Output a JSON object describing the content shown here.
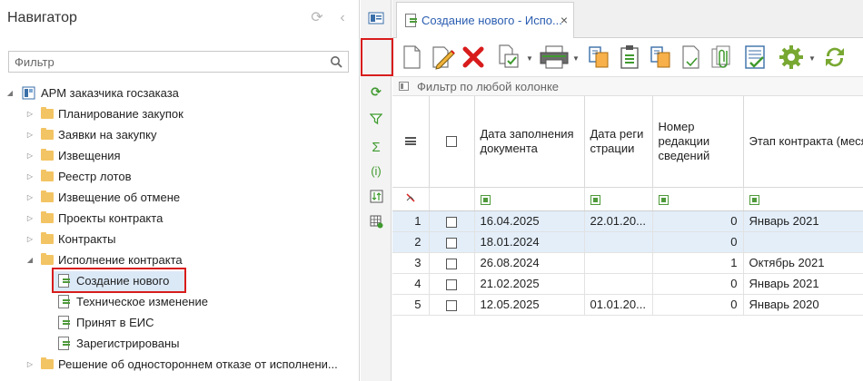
{
  "navigator": {
    "title": "Навигатор",
    "filter_placeholder": "Фильтр",
    "tree": {
      "root": "АРМ заказчика госзаказа",
      "items": [
        "Планирование закупок",
        "Заявки на закупку",
        "Извещения",
        "Реестр лотов",
        "Извещение об отмене",
        "Проекты контракта",
        "Контракты",
        "Исполнение контракта"
      ],
      "children": [
        "Создание нового",
        "Техническое изменение",
        "Принят в ЕИС",
        "Зарегистрированы"
      ],
      "last": "Решение об одностороннем отказе от исполнени..."
    }
  },
  "tab": {
    "label": "Создание нового - Испо...",
    "close": "×"
  },
  "grid": {
    "filter_placeholder": "Фильтр по любой колонке",
    "columns": [
      "Дата заполнения документа",
      "Дата регистрации",
      "Номер редакции сведений",
      "Этап контракта (месяц)"
    ],
    "rows": [
      {
        "n": "1",
        "date_fill": "16.04.2025",
        "date_reg": "22.01.20...",
        "edition": "0",
        "stage": "Январь 2021"
      },
      {
        "n": "2",
        "date_fill": "18.01.2024",
        "date_reg": "",
        "edition": "0",
        "stage": ""
      },
      {
        "n": "3",
        "date_fill": "26.08.2024",
        "date_reg": "",
        "edition": "1",
        "stage": "Октябрь 2021"
      },
      {
        "n": "4",
        "date_fill": "21.02.2025",
        "date_reg": "",
        "edition": "0",
        "stage": "Январь 2021"
      },
      {
        "n": "5",
        "date_fill": "12.05.2025",
        "date_reg": "01.01.20...",
        "edition": "0",
        "stage": "Январь 2020"
      }
    ]
  },
  "colors": {
    "accent_red": "#d81c1c",
    "tab_text": "#2a5db0",
    "selection": "#dbe9f7",
    "green": "#4e9a3a",
    "folder": "#f3c463"
  }
}
